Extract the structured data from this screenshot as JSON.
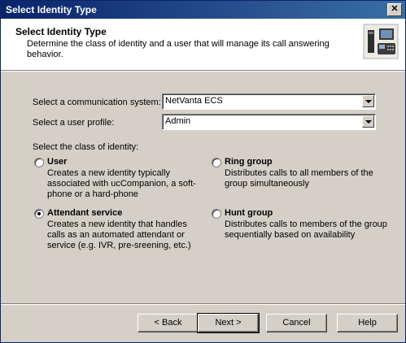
{
  "window": {
    "title": "Select Identity Type",
    "close_glyph": "✕"
  },
  "header": {
    "title": "Select Identity Type",
    "description": "Determine the class of identity and a user that will manage its call answering behavior.",
    "icon": "phone-pc-icon"
  },
  "form": {
    "system_label": "Select a communication system:",
    "system_value": "NetVanta ECS",
    "profile_label": "Select a user profile:",
    "profile_value": "Admin",
    "class_label": "Select the class of identity:"
  },
  "options": {
    "user": {
      "title": "User",
      "desc": "Creates a new identity typically associated with ucCompanion, a soft-phone or a hard-phone",
      "checked": false
    },
    "ring": {
      "title": "Ring group",
      "desc": "Distributes calls to all members of the group simultaneously",
      "checked": false
    },
    "attendant": {
      "title": "Attendant service",
      "desc": "Creates a new identity that handles calls as an automated attendant or service (e.g. IVR, pre-sreening, etc.)",
      "checked": true
    },
    "hunt": {
      "title": "Hunt group",
      "desc": "Distributes calls to members of the group sequentially based on availability",
      "checked": false
    }
  },
  "buttons": {
    "back": "< Back",
    "next": "Next >",
    "cancel": "Cancel",
    "help": "Help"
  }
}
